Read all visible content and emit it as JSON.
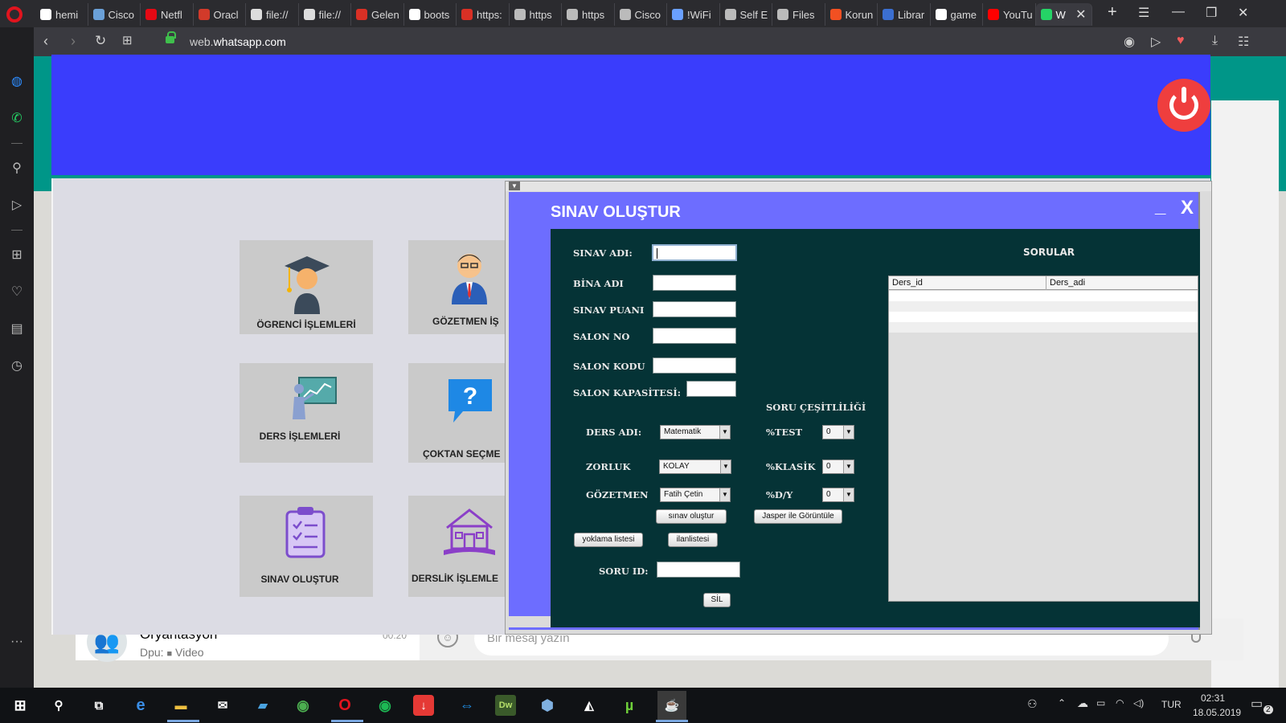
{
  "browser": {
    "tabs": [
      {
        "label": "hemi",
        "icon": "google-icon",
        "color": "#ffffff"
      },
      {
        "label": "Cisco",
        "icon": "cisco-icon",
        "color": "#6aa0d8"
      },
      {
        "label": "Netfl",
        "icon": "netflix-icon",
        "color": "#e50914"
      },
      {
        "label": "Oracl",
        "icon": "oracle-icon",
        "color": "#d23a2a"
      },
      {
        "label": "file://",
        "icon": "file-icon",
        "color": "#dddddd"
      },
      {
        "label": "file://",
        "icon": "file-icon",
        "color": "#dddddd"
      },
      {
        "label": "Gelen",
        "icon": "gmail-icon",
        "color": "#d93025"
      },
      {
        "label": "boots",
        "icon": "google-icon",
        "color": "#ffffff"
      },
      {
        "label": "https:",
        "icon": "gmail-icon",
        "color": "#d93025"
      },
      {
        "label": "https",
        "icon": "network-icon",
        "color": "#bbbbbb"
      },
      {
        "label": "https",
        "icon": "network-icon",
        "color": "#bbbbbb"
      },
      {
        "label": "Cisco",
        "icon": "network-icon",
        "color": "#bbbbbb"
      },
      {
        "label": "!WiFi",
        "icon": "wifi-icon",
        "color": "#6aa0ff"
      },
      {
        "label": "Self E",
        "icon": "network-icon",
        "color": "#bbbbbb"
      },
      {
        "label": "Files",
        "icon": "network-icon",
        "color": "#bbbbbb"
      },
      {
        "label": "Korun",
        "icon": "microsoft-icon",
        "color": "#f25022"
      },
      {
        "label": "Librar",
        "icon": "library-icon",
        "color": "#3b6fd1"
      },
      {
        "label": "game",
        "icon": "google-icon",
        "color": "#ffffff"
      },
      {
        "label": "YouTu",
        "icon": "youtube-icon",
        "color": "#ff0000"
      },
      {
        "label": "W",
        "icon": "whatsapp-icon",
        "color": "#25d366",
        "active": true
      }
    ],
    "url_prefix": "web.",
    "url_domain": "whatsapp.com"
  },
  "whatsapp": {
    "chat_name": "Oryantasyon",
    "chat_time": "00:20",
    "chat_preview_sender": "Dpu:",
    "chat_preview_text": "Video",
    "message_placeholder": "Bir mesaj yazın"
  },
  "app": {
    "accent_header": "#3a3dfc",
    "power_color": "#ef3e3e",
    "cards": [
      {
        "label": "ÖGRENCİ İŞLEMLERİ",
        "icon": "student-graduate-icon"
      },
      {
        "label": "GÖZETMEN İŞ",
        "icon": "supervisor-icon"
      },
      {
        "label": "DERS İŞLEMLERİ",
        "icon": "teacher-board-icon"
      },
      {
        "label": "ÇOKTAN SEÇME",
        "icon": "question-bubble-icon"
      },
      {
        "label": "SINAV OLUŞTUR",
        "icon": "clipboard-checklist-icon"
      },
      {
        "label": "DERSLİK İŞLEMLE",
        "icon": "school-building-icon"
      }
    ]
  },
  "sinav_form": {
    "title": "SINAV OLUŞTUR",
    "minimize": "_",
    "close": "X",
    "labels": {
      "sinav_adi": "SINAV ADI:",
      "bina_adi": "BİNA ADI",
      "sinav_puani": "SINAV PUANI",
      "salon_no": "SALON NO",
      "salon_kodu": "SALON KODU",
      "salon_kapasitesi": "SALON KAPASİTESİ:",
      "soru_cesitliligi": "SORU ÇEŞİTLİLİĞİ",
      "ders_adi": "DERS ADI:",
      "zorluk": "ZORLUK",
      "gozetmen": "GÖZETMEN",
      "test": "%TEST",
      "klasik": "%KLASİK",
      "dy": "%D/Y",
      "soru_id": "SORU ID:"
    },
    "values": {
      "ders_adi": "Matematik",
      "zorluk": "KOLAY",
      "gozetmen": "Fatih Çetin",
      "test": "0",
      "klasik": "0",
      "dy": "0"
    },
    "buttons": {
      "sinav_olustur": "sınav oluştur",
      "jasper": "Jasper ile Görüntüle",
      "yoklama": "yoklama listesi",
      "ilan": "ilanlistesi",
      "sil": "SİL"
    },
    "sorular_title": "SORULAR",
    "table_columns": [
      "Ders_id",
      "Ders_adi"
    ]
  },
  "taskbar": {
    "language": "TUR",
    "time": "02:31",
    "date": "18.05.2019",
    "notification_count": "2"
  }
}
